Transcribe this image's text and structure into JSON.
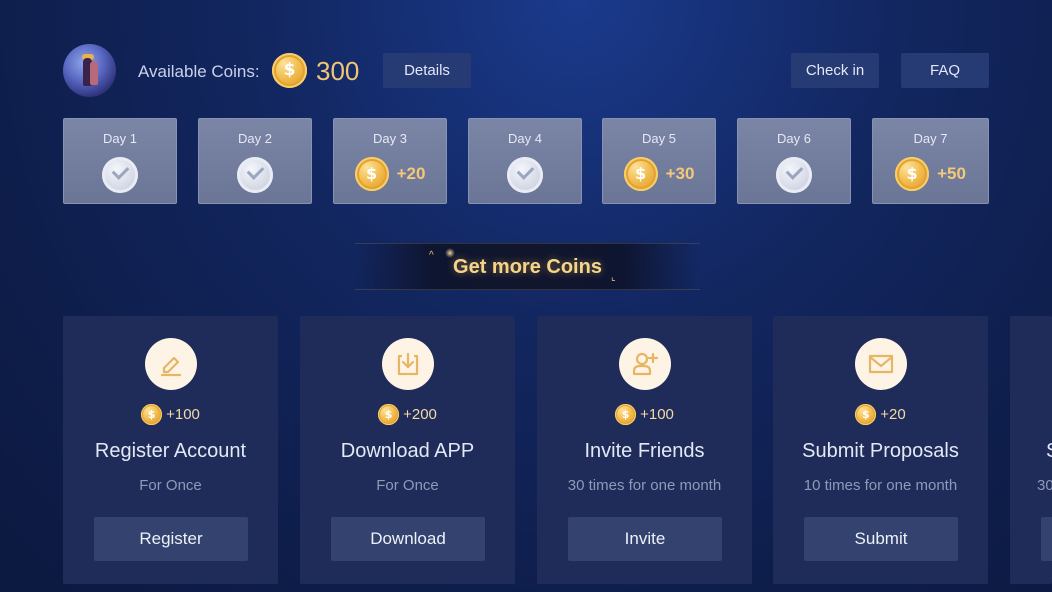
{
  "header": {
    "avatar_icon": "user-avatar",
    "coins_label": "Available Coins:",
    "coin_symbol": "$",
    "coins_total": "300",
    "details_label": "Details",
    "checkin_label": "Check in",
    "faq_label": "FAQ"
  },
  "days": [
    {
      "label": "Day 1",
      "status": "checked",
      "reward": ""
    },
    {
      "label": "Day 2",
      "status": "checked",
      "reward": ""
    },
    {
      "label": "Day 3",
      "status": "reward",
      "reward": "+20"
    },
    {
      "label": "Day 4",
      "status": "checked",
      "reward": ""
    },
    {
      "label": "Day 5",
      "status": "reward",
      "reward": "+30"
    },
    {
      "label": "Day 6",
      "status": "checked",
      "reward": ""
    },
    {
      "label": "Day 7",
      "status": "reward",
      "reward": "+50"
    }
  ],
  "banner": {
    "title": "Get more Coins"
  },
  "tasks": [
    {
      "icon": "edit-icon",
      "reward": "+100",
      "title": "Register Account",
      "frequency": "For Once",
      "button": "Register"
    },
    {
      "icon": "download-icon",
      "reward": "+200",
      "title": "Download APP",
      "frequency": "For Once",
      "button": "Download"
    },
    {
      "icon": "add-user-icon",
      "reward": "+100",
      "title": "Invite Friends",
      "frequency": "30 times for one month",
      "button": "Invite"
    },
    {
      "icon": "mail-icon",
      "reward": "+20",
      "title": "Submit Proposals",
      "frequency": "10 times for one month",
      "button": "Submit"
    },
    {
      "icon": "",
      "reward": "",
      "title": "S",
      "frequency": "30",
      "button": ""
    }
  ],
  "colors": {
    "background": "#12265f",
    "gold": "#f3c572",
    "card": "#1f2c5a",
    "button": "#33426e"
  }
}
